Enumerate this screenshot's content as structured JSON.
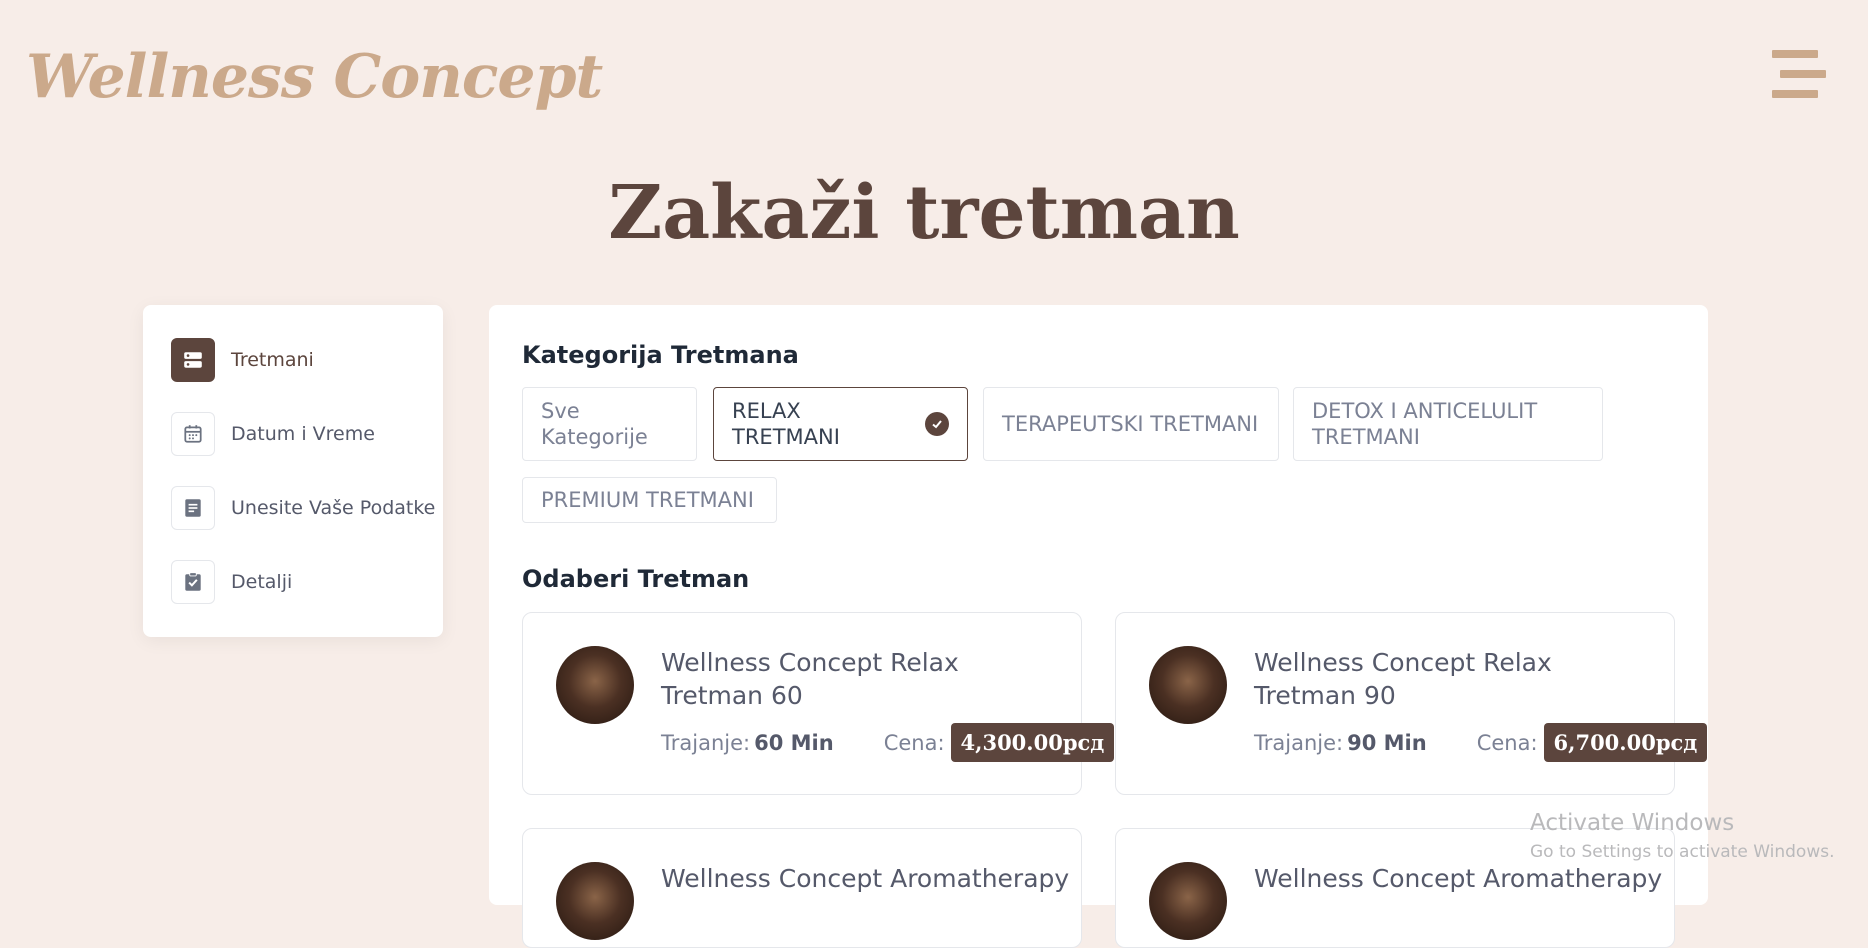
{
  "header": {
    "logo": "Wellness Concept",
    "menu_icon": "hamburger-icon"
  },
  "page": {
    "title": "Zakaži tretman"
  },
  "steps": [
    {
      "label": "Tretmani",
      "icon": "services-icon",
      "active": true
    },
    {
      "label": "Datum i Vreme",
      "icon": "calendar-icon",
      "active": false
    },
    {
      "label": "Unesite Vaše Podatke",
      "icon": "document-icon",
      "active": false
    },
    {
      "label": "Detalji",
      "icon": "clipboard-check-icon",
      "active": false
    }
  ],
  "categories": {
    "title": "Kategorija Tretmana",
    "items": [
      {
        "label": "Sve Kategorije",
        "selected": false
      },
      {
        "label": "RELAX TRETMANI",
        "selected": true
      },
      {
        "label": "TERAPEUTSKI TRETMANI",
        "selected": false
      },
      {
        "label": "DETOX I ANTICELULIT TRETMANI",
        "selected": false
      },
      {
        "label": "PREMIUM TRETMANI",
        "selected": false
      }
    ]
  },
  "treatments": {
    "title": "Odaberi Tretman",
    "duration_label": "Trajanje:",
    "price_label": "Cena:",
    "items": [
      {
        "name": "Wellness Concept Relax Tretman 60",
        "duration": "60 Min",
        "price": "4,300.00рсд"
      },
      {
        "name": "Wellness Concept Relax Tretman 90",
        "duration": "90 Min",
        "price": "6,700.00рсд"
      },
      {
        "name": "Wellness Concept Aromatherapy"
      },
      {
        "name": "Wellness Concept Aromatherapy"
      }
    ]
  },
  "watermark": {
    "line1": "Activate Windows",
    "line2": "Go to Settings to activate Windows."
  },
  "colors": {
    "background": "#f7ede8",
    "accent": "#5c453d",
    "logo": "#cba98b"
  }
}
